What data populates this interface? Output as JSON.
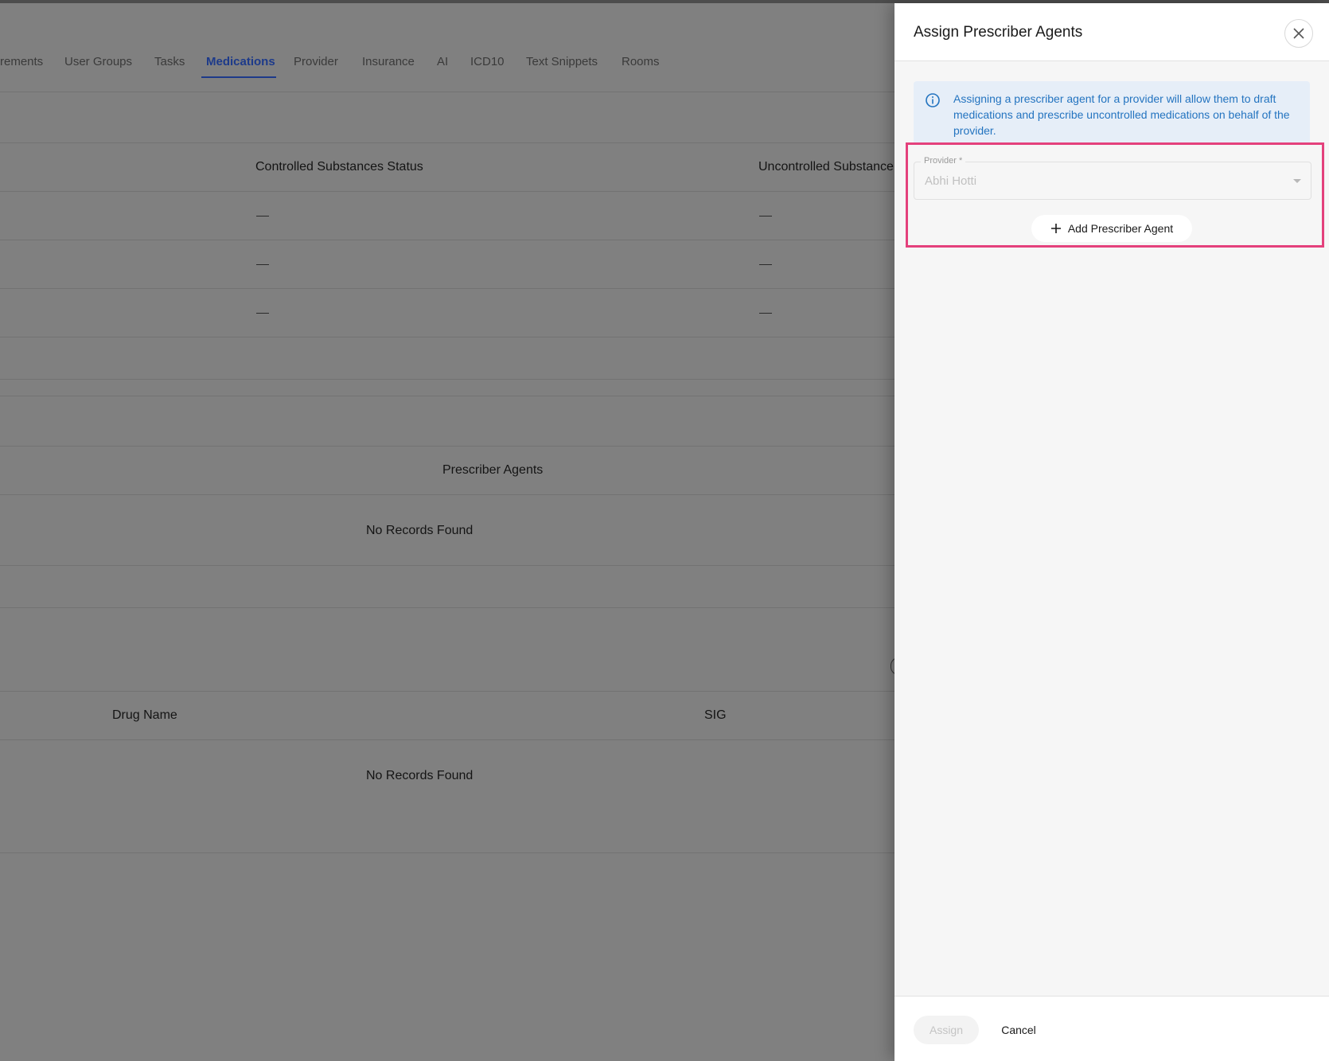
{
  "tabs": [
    {
      "label": "rements"
    },
    {
      "label": "User Groups"
    },
    {
      "label": "Tasks"
    },
    {
      "label": "Medications",
      "active": true
    },
    {
      "label": "Provider"
    },
    {
      "label": "Insurance"
    },
    {
      "label": "AI"
    },
    {
      "label": "ICD10"
    },
    {
      "label": "Text Snippets"
    },
    {
      "label": "Rooms"
    }
  ],
  "status_table": {
    "headers": [
      "Controlled Substances Status",
      "Uncontrolled Substance"
    ],
    "rows": [
      [
        "—",
        "—"
      ],
      [
        "—",
        "—"
      ],
      [
        "—",
        "—"
      ]
    ]
  },
  "prescriber_agents_section": {
    "header": "Prescriber Agents",
    "empty_text": "No Records Found"
  },
  "drug_table": {
    "headers": [
      "Drug Name",
      "SIG"
    ],
    "empty_text": "No Records Found"
  },
  "drawer": {
    "title": "Assign Prescriber Agents",
    "info_text": "Assigning a prescriber agent for a provider will allow them to draft medications and prescribe uncontrolled medications on behalf of the provider.",
    "provider_label": "Provider *",
    "provider_value": "Abhi Hotti",
    "add_agent_label": "Add Prescriber Agent",
    "assign_label": "Assign",
    "cancel_label": "Cancel"
  },
  "colors": {
    "accent": "#1d3a8a",
    "info": "#2474c0",
    "highlight": "#e4417c"
  }
}
